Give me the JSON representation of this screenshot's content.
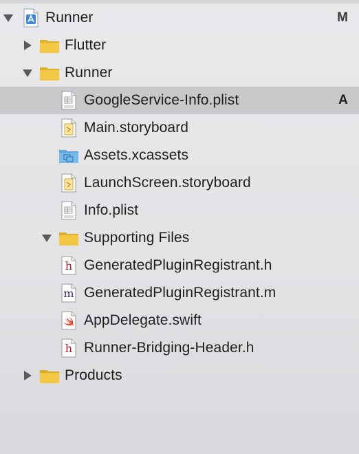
{
  "navigator": {
    "items": [
      {
        "label": "Runner",
        "badge": "M",
        "icon": "xcode-project-icon",
        "disclosure": "expanded",
        "indent": 0
      },
      {
        "label": "Flutter",
        "badge": "",
        "icon": "folder-icon",
        "disclosure": "collapsed",
        "indent": 1
      },
      {
        "label": "Runner",
        "badge": "",
        "icon": "folder-icon",
        "disclosure": "expanded",
        "indent": 1
      },
      {
        "label": "GoogleService-Info.plist",
        "badge": "A",
        "icon": "plist-file-icon",
        "disclosure": "none",
        "indent": 2,
        "selected": true
      },
      {
        "label": "Main.storyboard",
        "badge": "",
        "icon": "storyboard-file-icon",
        "disclosure": "none",
        "indent": 2
      },
      {
        "label": "Assets.xcassets",
        "badge": "",
        "icon": "asset-catalog-icon",
        "disclosure": "none",
        "indent": 2
      },
      {
        "label": "LaunchScreen.storyboard",
        "badge": "",
        "icon": "storyboard-file-icon",
        "disclosure": "none",
        "indent": 2
      },
      {
        "label": "Info.plist",
        "badge": "",
        "icon": "plist-file-icon",
        "disclosure": "none",
        "indent": 2
      },
      {
        "label": "Supporting Files",
        "badge": "",
        "icon": "folder-icon",
        "disclosure": "expanded",
        "indent": 2
      },
      {
        "label": "GeneratedPluginRegistrant.h",
        "badge": "",
        "icon": "header-file-icon",
        "disclosure": "none",
        "indent": 2
      },
      {
        "label": "GeneratedPluginRegistrant.m",
        "badge": "",
        "icon": "objc-file-icon",
        "disclosure": "none",
        "indent": 2
      },
      {
        "label": "AppDelegate.swift",
        "badge": "",
        "icon": "swift-file-icon",
        "disclosure": "none",
        "indent": 2
      },
      {
        "label": "Runner-Bridging-Header.h",
        "badge": "",
        "icon": "header-file-icon",
        "disclosure": "none",
        "indent": 2
      },
      {
        "label": "Products",
        "badge": "",
        "icon": "folder-icon",
        "disclosure": "collapsed",
        "indent": 1
      }
    ],
    "file_letters": {
      "header": "h",
      "objc": "m"
    },
    "colors": {
      "folder": "#f2c744",
      "folder_dark": "#dcae2a",
      "asset_folder": "#7bbbe9",
      "selection": "#c8c8cb",
      "swift": "#f05138"
    }
  }
}
